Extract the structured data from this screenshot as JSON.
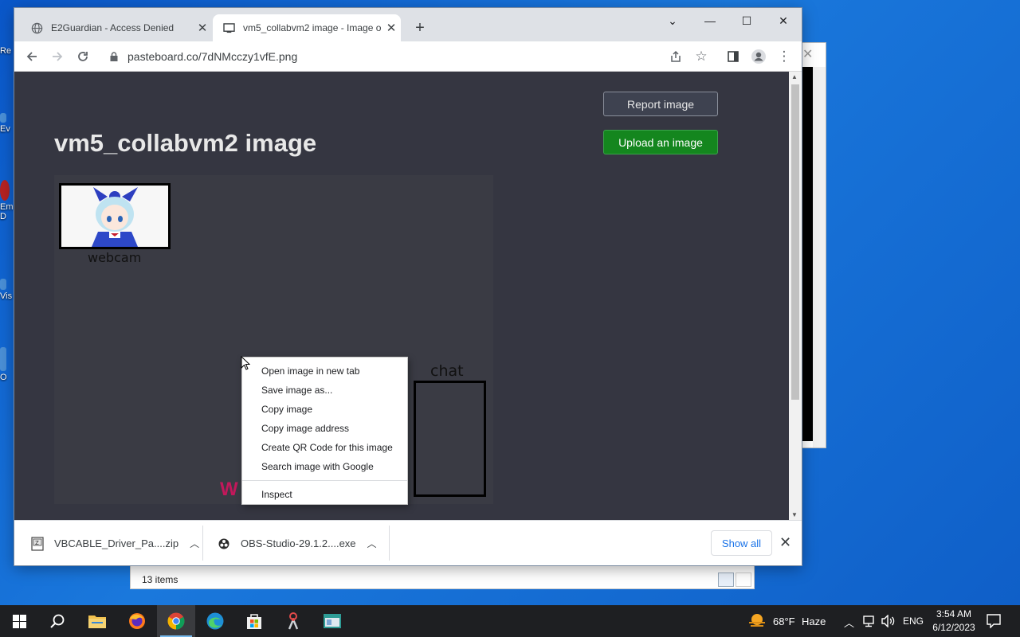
{
  "desktop_labels": [
    "Re",
    "Ev",
    "Em",
    "D",
    "Vis",
    "O"
  ],
  "explorer": {
    "items_count": "13 items"
  },
  "browser": {
    "tabs": [
      {
        "title": "E2Guardian - Access Denied",
        "active": false
      },
      {
        "title": "vm5_collabvm2 image - Image o",
        "active": true
      }
    ],
    "url": "pasteboard.co/7dNMcczy1vfE.png"
  },
  "page": {
    "title": "vm5_collabvm2 image",
    "report_button": "Report image",
    "upload_button": "Upload an image",
    "image": {
      "webcam_label": "webcam",
      "chat_label": "chat",
      "watermark": "W"
    }
  },
  "context_menu": {
    "items": [
      "Open image in new tab",
      "Save image as...",
      "Copy image",
      "Copy image address",
      "Create QR Code for this image",
      "Search image with Google"
    ],
    "inspect": "Inspect"
  },
  "downloads": {
    "items": [
      {
        "name": "VBCABLE_Driver_Pa....zip"
      },
      {
        "name": "OBS-Studio-29.1.2....exe"
      }
    ],
    "show_all": "Show all"
  },
  "taskbar": {
    "weather": {
      "temp": "68°F",
      "condition": "Haze"
    },
    "language": "ENG",
    "time": "3:54 AM",
    "date": "6/12/2023"
  }
}
